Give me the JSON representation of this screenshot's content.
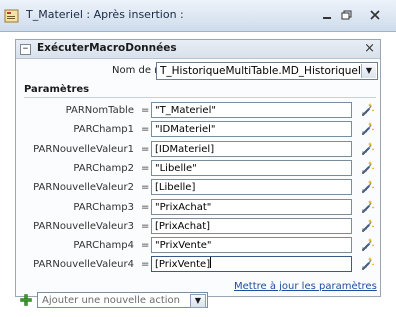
{
  "window": {
    "title": "T_Materiel : Après insertion :",
    "min_icon": "minimize-icon",
    "restore_icon": "restore-icon",
    "close_icon": "close-icon"
  },
  "action": {
    "title": "ExécuterMacroDonnées",
    "collapse_symbol": "−",
    "close_symbol": "×",
    "macro_label": "Nom de macro",
    "macro_value": "T_HistoriqueMultiTable.MD_HistoriqueMultiTable",
    "params_header": "Paramètres",
    "parameters": [
      {
        "label": "PARNomTable",
        "eq": "=",
        "value": "\"T_Materiel\""
      },
      {
        "label": "PARChamp1",
        "eq": "=",
        "value": "\"IDMateriel\""
      },
      {
        "label": "PARNouvelleValeur1",
        "eq": "=",
        "value": "[IDMateriel]"
      },
      {
        "label": "PARChamp2",
        "eq": "=",
        "value": "\"Libelle\""
      },
      {
        "label": "PARNouvelleValeur2",
        "eq": "=",
        "value": "[Libelle]"
      },
      {
        "label": "PARChamp3",
        "eq": "=",
        "value": "\"PrixAchat\""
      },
      {
        "label": "PARNouvelleValeur3",
        "eq": "=",
        "value": "[PrixAchat]"
      },
      {
        "label": "PARChamp4",
        "eq": "=",
        "value": "\"PrixVente\""
      },
      {
        "label": "PARNouvelleValeur4",
        "eq": "=",
        "value": "[PrixVente]"
      }
    ],
    "update_link": "Mettre à jour les paramètres"
  },
  "add_action": {
    "placeholder": "Ajouter une nouvelle action"
  },
  "colors": {
    "accent": "#1e4fa1",
    "plus_green": "#3a9a2e"
  }
}
